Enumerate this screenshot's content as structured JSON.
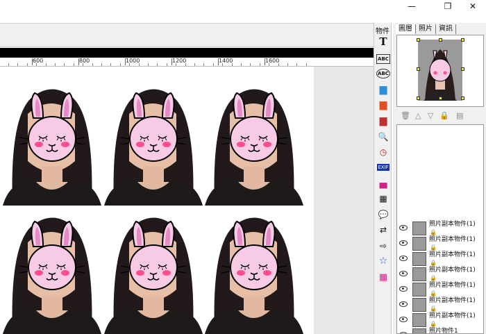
{
  "window": {
    "min_glyph": "—",
    "max_glyph": "❐",
    "close_glyph": "✕"
  },
  "ruler": {
    "labels": [
      "600",
      "800",
      "1000",
      "1200",
      "1400",
      "1600"
    ]
  },
  "tools": {
    "title": "物件",
    "items": [
      {
        "icon": "text-tool-icon",
        "glyph": "T"
      },
      {
        "icon": "text-box-icon",
        "glyph": "ABC"
      },
      {
        "icon": "circle-text-icon",
        "glyph": "ABC"
      },
      {
        "icon": "image-icon",
        "glyph": "▆"
      },
      {
        "icon": "photo-icon",
        "glyph": "▆"
      },
      {
        "icon": "multi-photo-icon",
        "glyph": "▆"
      },
      {
        "icon": "magnifier-icon",
        "glyph": "🔍"
      },
      {
        "icon": "clock-icon",
        "glyph": "◷"
      },
      {
        "icon": "exif-icon",
        "glyph": "EXIF"
      },
      {
        "icon": "cake-icon",
        "glyph": "▄"
      },
      {
        "icon": "calendar-icon",
        "glyph": "▦"
      },
      {
        "icon": "speech-bubble-icon",
        "glyph": "💬"
      },
      {
        "icon": "arrows-swap-icon",
        "glyph": "⇄"
      },
      {
        "icon": "arrow-right-icon",
        "glyph": "⇨"
      },
      {
        "icon": "star-frame-icon",
        "glyph": "☆"
      },
      {
        "icon": "color-grid-icon",
        "glyph": "▦"
      }
    ]
  },
  "panel": {
    "tabs": [
      "圖層",
      "照片",
      "資訊"
    ],
    "layer_toolbar": [
      {
        "icon": "trash-icon",
        "glyph": "🗑"
      },
      {
        "icon": "move-up-icon",
        "glyph": "△"
      },
      {
        "icon": "move-down-icon",
        "glyph": "▽"
      },
      {
        "icon": "lock-layer-icon",
        "glyph": "🔒"
      },
      {
        "icon": "layer-properties-icon",
        "glyph": "▤"
      }
    ],
    "layers": [
      {
        "name": "照片副本物件(1)"
      },
      {
        "name": "照片副本物件(1)"
      },
      {
        "name": "照片副本物件(1)"
      },
      {
        "name": "照片副本物件(1)"
      },
      {
        "name": "照片副本物件(1)"
      },
      {
        "name": "照片副本物件(1)"
      },
      {
        "name": "照片副本物件(1)"
      },
      {
        "name": "照片物件1"
      }
    ]
  },
  "colors": {
    "accent_pink": "#f2a8d4",
    "cheek": "#ff4d8d",
    "handle": "#ffeb00"
  }
}
